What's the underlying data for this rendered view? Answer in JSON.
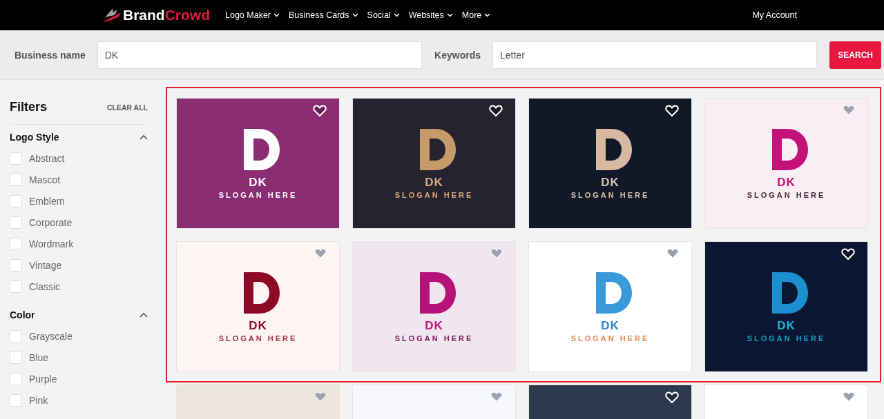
{
  "header": {
    "brand": {
      "first": "Brand",
      "second": "Crowd"
    },
    "nav": [
      {
        "label": "Logo Maker"
      },
      {
        "label": "Business Cards"
      },
      {
        "label": "Social"
      },
      {
        "label": "Websites"
      },
      {
        "label": "More"
      }
    ],
    "account": "My Account"
  },
  "search": {
    "fields": [
      {
        "label": "Business name",
        "value": "DK"
      },
      {
        "label": "Keywords",
        "value": "Letter"
      }
    ],
    "button": "SEARCH"
  },
  "filters": {
    "title": "Filters",
    "clear": "CLEAR ALL",
    "groups": [
      {
        "title": "Logo Style",
        "expanded": true,
        "options": [
          {
            "label": "Abstract",
            "checked": false
          },
          {
            "label": "Mascot",
            "checked": false
          },
          {
            "label": "Emblem",
            "checked": false
          },
          {
            "label": "Corporate",
            "checked": false
          },
          {
            "label": "Wordmark",
            "checked": false
          },
          {
            "label": "Vintage",
            "checked": false
          },
          {
            "label": "Classic",
            "checked": false
          }
        ]
      },
      {
        "title": "Color",
        "expanded": true,
        "options": [
          {
            "label": "Grayscale",
            "checked": false
          },
          {
            "label": "Blue",
            "checked": false
          },
          {
            "label": "Purple",
            "checked": false
          },
          {
            "label": "Pink",
            "checked": false
          }
        ]
      }
    ]
  },
  "results": {
    "highlighted": [
      {
        "color": "#8a2d73",
        "name": "DK",
        "slogan": "SLOGAN HERE"
      },
      {
        "color": "#25232f",
        "name": "DK",
        "slogan": "SLOGAN HERE"
      },
      {
        "color": "#111827",
        "name": "DK",
        "slogan": "SLOGAN HERE"
      },
      {
        "color": "#f8eef3",
        "name": "DK",
        "slogan": "SLOGAN HERE"
      },
      {
        "color": "#fdf5f2",
        "name": "DK",
        "slogan": "SLOGAN HERE"
      },
      {
        "color": "#f0e6ee",
        "name": "DK",
        "slogan": "SLOGAN HERE"
      },
      {
        "color": "#ffffff",
        "name": "DK",
        "slogan": "SLOGAN HERE"
      },
      {
        "color": "#0b1733",
        "name": "DK",
        "slogan": "SLOGAN HERE"
      }
    ],
    "more": [
      {
        "color": "#ece6dc"
      },
      {
        "color": "#f7f8fc"
      },
      {
        "color": "#2d3a4e"
      },
      {
        "color": "#ffffff"
      }
    ]
  }
}
